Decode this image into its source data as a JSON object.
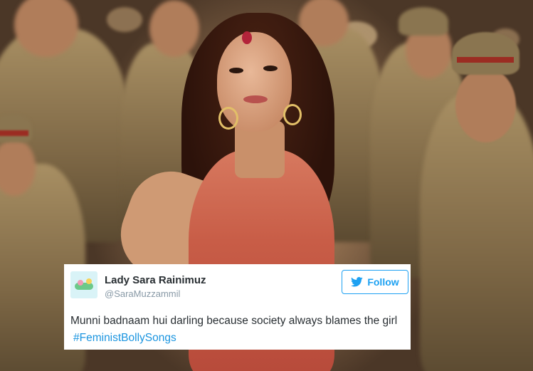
{
  "tweet": {
    "display_name": "Lady Sara Rainimuz",
    "handle": "@SaraMuzzammil",
    "follow_label": "Follow",
    "text": "Munni badnaam hui darling because society always blames the girl",
    "hashtag": "#FeministBollySongs",
    "accent_color": "#1da1f2",
    "avatar_icon": "avatar-image",
    "follow_icon": "twitter-bird-icon"
  },
  "photo": {
    "subject": "photo-background"
  }
}
